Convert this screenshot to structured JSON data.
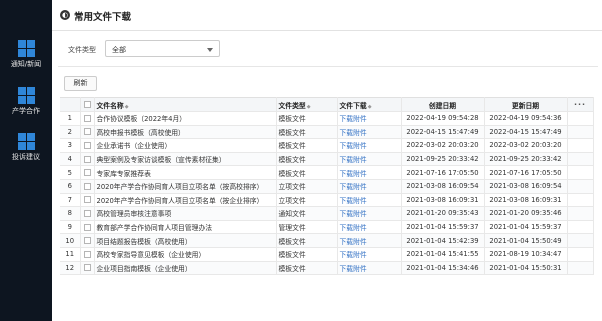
{
  "sidebar": {
    "items": [
      {
        "label": "通知/新闻",
        "icon": "windows-icon"
      },
      {
        "label": "产学合作",
        "icon": "windows-icon"
      },
      {
        "label": "投诉建议",
        "icon": "windows-icon"
      }
    ]
  },
  "header": {
    "title": "常用文件下载",
    "icon": "globe-icon"
  },
  "filter": {
    "label": "文件类型",
    "value": "全部"
  },
  "toolbar": {
    "refresh_label": "刷新"
  },
  "table": {
    "columns": {
      "name": "文件名称",
      "type": "文件类型",
      "download": "文件下载",
      "created": "创建日期",
      "updated": "更新日期",
      "more": "···"
    },
    "rows": [
      {
        "no": "1",
        "name": "合作协议模板（2022年4月）",
        "type": "模板文件",
        "download": "下载附件",
        "created": "2022-04-19 09:54:28",
        "updated": "2022-04-19 09:54:36"
      },
      {
        "no": "2",
        "name": "高校申报书模板（高校使用）",
        "type": "模板文件",
        "download": "下载附件",
        "created": "2022-04-15 15:47:49",
        "updated": "2022-04-15 15:47:49"
      },
      {
        "no": "3",
        "name": "企业承诺书（企业使用）",
        "type": "模板文件",
        "download": "下载附件",
        "created": "2022-03-02 20:03:20",
        "updated": "2022-03-02 20:03:20"
      },
      {
        "no": "4",
        "name": "典型案例及专家访谈模板（宣传素材征集）",
        "type": "模板文件",
        "download": "下载附件",
        "created": "2021-09-25 20:33:42",
        "updated": "2021-09-25 20:33:42"
      },
      {
        "no": "5",
        "name": "专家库专家推荐表",
        "type": "模板文件",
        "download": "下载附件",
        "created": "2021-07-16 17:05:50",
        "updated": "2021-07-16 17:05:50"
      },
      {
        "no": "6",
        "name": "2020年产学合作协同育人项目立项名单（按高校排序）",
        "type": "立项文件",
        "download": "下载附件",
        "created": "2021-03-08 16:09:54",
        "updated": "2021-03-08 16:09:54"
      },
      {
        "no": "7",
        "name": "2020年产学合作协同育人项目立项名单（按企业排序）",
        "type": "立项文件",
        "download": "下载附件",
        "created": "2021-03-08 16:09:31",
        "updated": "2021-03-08 16:09:31"
      },
      {
        "no": "8",
        "name": "高校管理员审核注意事项",
        "type": "通知文件",
        "download": "下载附件",
        "created": "2021-01-20 09:35:43",
        "updated": "2021-01-20 09:35:46"
      },
      {
        "no": "9",
        "name": "教育部产学合作协同育人项目管理办法",
        "type": "管理文件",
        "download": "下载附件",
        "created": "2021-01-04 15:59:37",
        "updated": "2021-01-04 15:59:37"
      },
      {
        "no": "10",
        "name": "项目结题报告模板（高校使用）",
        "type": "模板文件",
        "download": "下载附件",
        "created": "2021-01-04 15:42:39",
        "updated": "2021-01-04 15:50:49"
      },
      {
        "no": "11",
        "name": "高校专家指导意见模板（企业使用）",
        "type": "模板文件",
        "download": "下载附件",
        "created": "2021-01-04 15:41:55",
        "updated": "2021-08-19 10:34:47"
      },
      {
        "no": "12",
        "name": "企业项目指南模板（企业使用）",
        "type": "模板文件",
        "download": "下载附件",
        "created": "2021-01-04 15:34:46",
        "updated": "2021-01-04 15:50:31"
      }
    ]
  }
}
